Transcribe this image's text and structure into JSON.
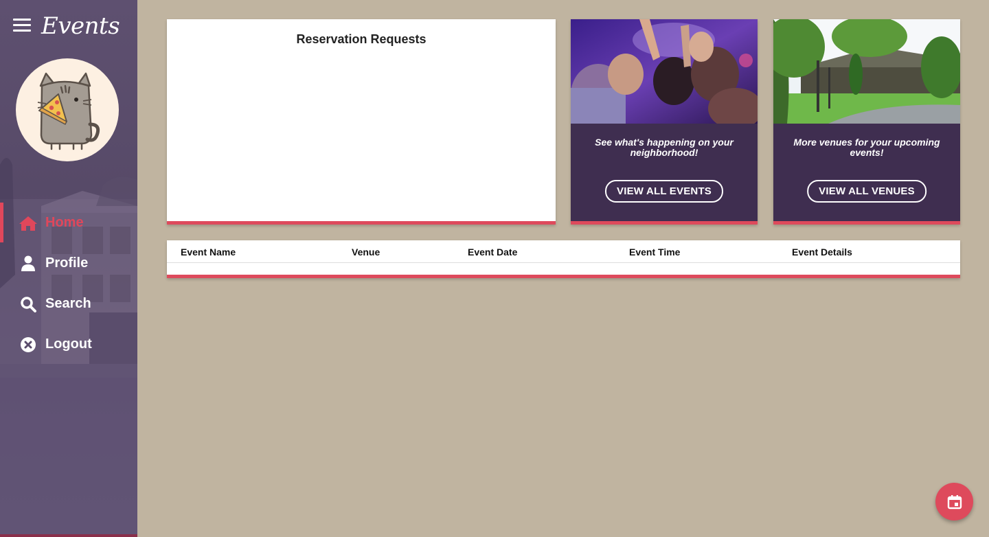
{
  "app": {
    "brand": "Events"
  },
  "sidebar": {
    "items": [
      {
        "label": "Home",
        "icon": "home-icon",
        "active": true
      },
      {
        "label": "Profile",
        "icon": "user-icon",
        "active": false
      },
      {
        "label": "Search",
        "icon": "search-icon",
        "active": false
      },
      {
        "label": "Logout",
        "icon": "close-circle-icon",
        "active": false
      }
    ]
  },
  "reservations": {
    "title": "Reservation Requests"
  },
  "promos": {
    "events": {
      "text": "See what's happening on your neighborhood!",
      "button": "VIEW ALL EVENTS"
    },
    "venues": {
      "text": "More venues for your upcoming events!",
      "button": "VIEW ALL VENUES"
    }
  },
  "table": {
    "columns": [
      "Event Name",
      "Venue",
      "Event Date",
      "Event Time",
      "Event Details"
    ],
    "rows": []
  },
  "fab": {
    "icon": "calendar-icon"
  },
  "colors": {
    "accent": "#de4a5c",
    "sidebar": "#5a4c6c",
    "promo_bg": "#3f2e50",
    "background": "#c0b4a0"
  }
}
